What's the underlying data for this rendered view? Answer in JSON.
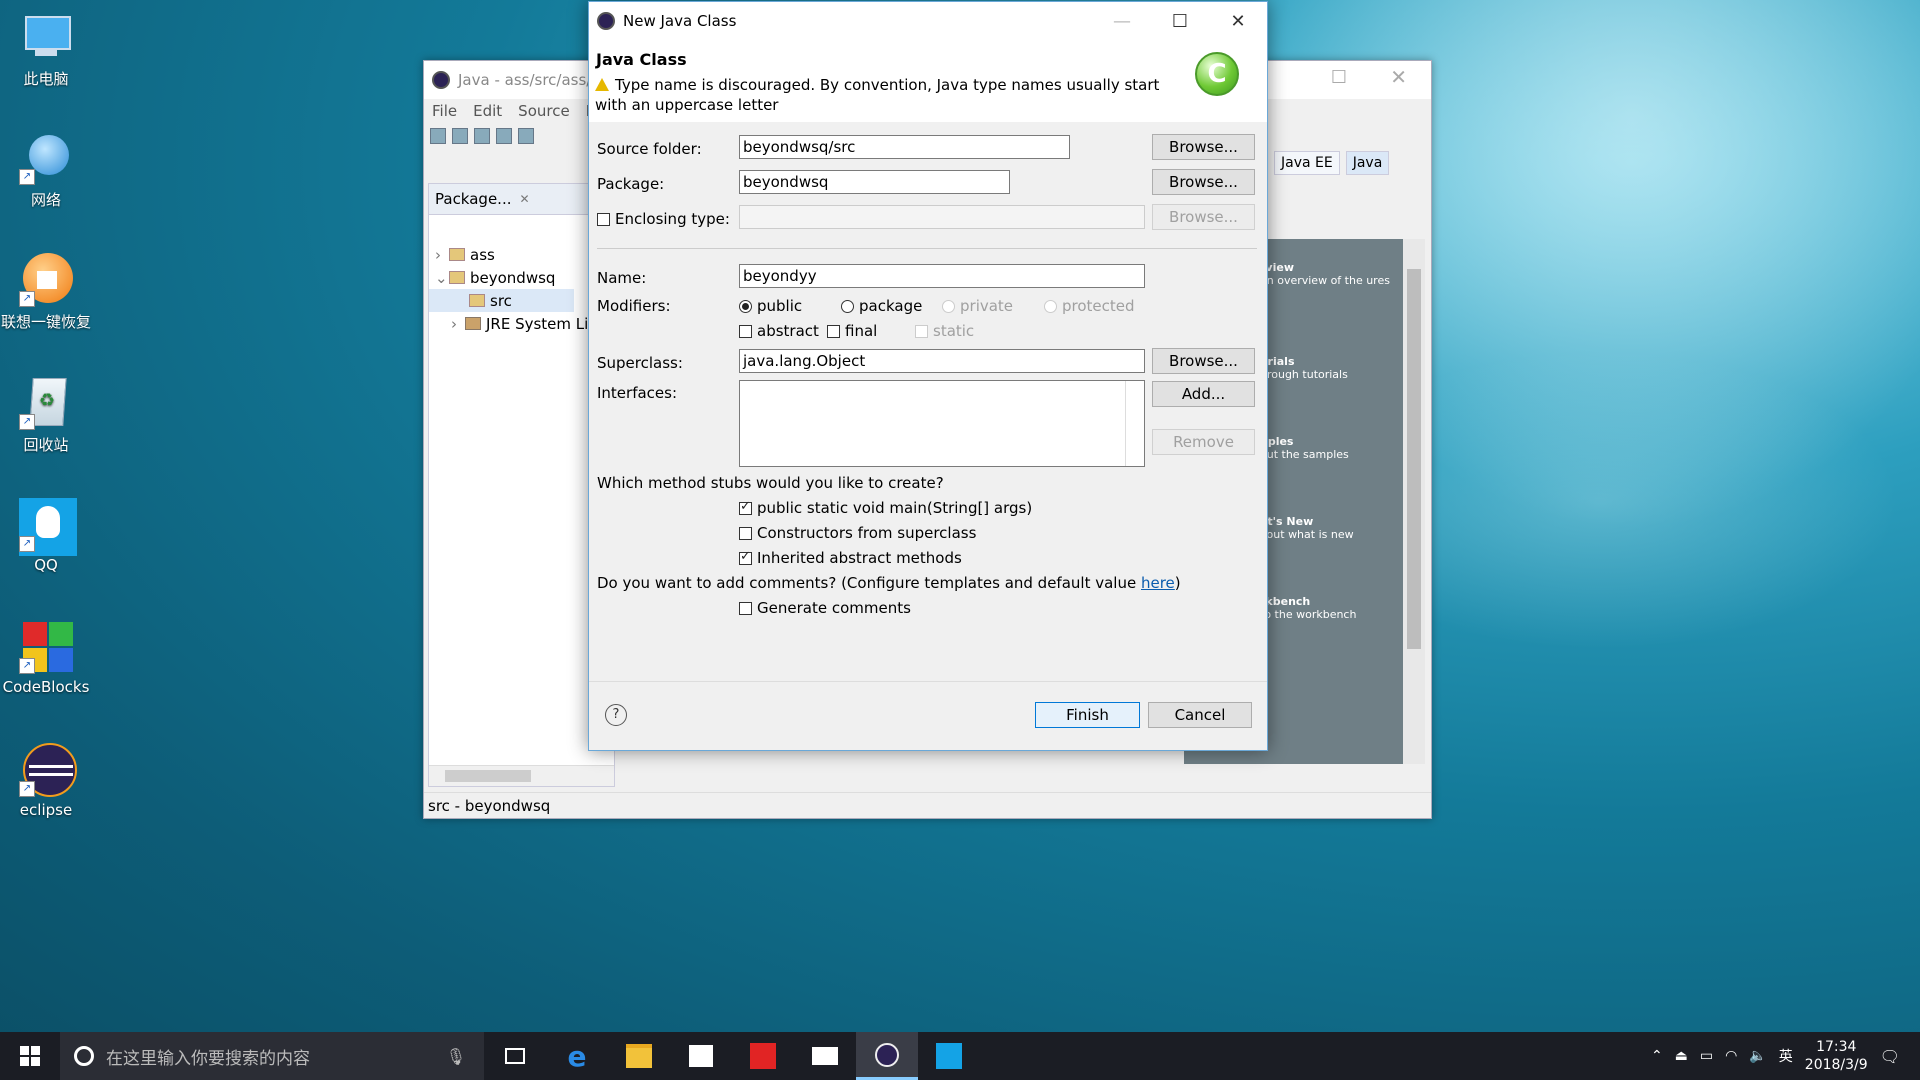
{
  "desktop": {
    "icons": [
      {
        "label": "此电脑",
        "icon": "computer-icon"
      },
      {
        "label": "网络",
        "icon": "network-icon"
      },
      {
        "label": "联想一键恢复",
        "icon": "lenovo-recovery-icon"
      },
      {
        "label": "回收站",
        "icon": "recycle-bin-icon"
      },
      {
        "label": "QQ",
        "icon": "qq-icon"
      },
      {
        "label": "CodeBlocks",
        "icon": "codeblocks-icon"
      },
      {
        "label": "eclipse",
        "icon": "eclipse-icon"
      }
    ]
  },
  "eclipse": {
    "title": "Java - ass/src/ass/",
    "menu": [
      "File",
      "Edit",
      "Source",
      "R"
    ],
    "package_tab": "Package...",
    "tree": [
      {
        "label": "ass"
      },
      {
        "label": "beyondwsq"
      },
      {
        "label": "src"
      },
      {
        "label": "JRE System Li"
      }
    ],
    "perspectives": [
      "Java EE",
      "Java"
    ],
    "welcome": [
      {
        "title": "rview",
        "desc": "an overview of the ures"
      },
      {
        "title": "orials",
        "desc": "hrough tutorials"
      },
      {
        "title": "nples",
        "desc": "out the samples"
      },
      {
        "title": "at's New",
        "desc": "l out what is new"
      },
      {
        "title": "rkbench",
        "desc": "to the workbench"
      }
    ],
    "status": "src - beyondwsq"
  },
  "dialog": {
    "window_title": "New Java Class",
    "header_title": "Java Class",
    "warning": "Type name is discouraged. By convention, Java type names usually start with an uppercase letter",
    "source_folder_label": "Source folder:",
    "source_folder_value": "beyondwsq/src",
    "package_label": "Package:",
    "package_value": "beyondwsq",
    "enclosing_label": "Enclosing type:",
    "browse": "Browse...",
    "name_label": "Name:",
    "name_value": "beyondyy",
    "modifiers_label": "Modifiers:",
    "mod_public": "public",
    "mod_package": "package",
    "mod_private": "private",
    "mod_protected": "protected",
    "mod_abstract": "abstract",
    "mod_final": "final",
    "mod_static": "static",
    "superclass_label": "Superclass:",
    "superclass_value": "java.lang.Object",
    "interfaces_label": "Interfaces:",
    "add": "Add...",
    "remove": "Remove",
    "stubs_question": "Which method stubs would you like to create?",
    "stub_main": "public static void main(String[] args)",
    "stub_constructors": "Constructors from superclass",
    "stub_inherited": "Inherited abstract methods",
    "comments_question_pre": "Do you want to add comments? (Configure templates and default value ",
    "comments_link": "here",
    "comments_question_post": ")",
    "generate_comments": "Generate comments",
    "finish": "Finish",
    "cancel": "Cancel",
    "help": "?"
  },
  "taskbar": {
    "search_placeholder": "在这里输入你要搜索的内容",
    "ime": "英",
    "time": "17:34",
    "date": "2018/3/9"
  }
}
